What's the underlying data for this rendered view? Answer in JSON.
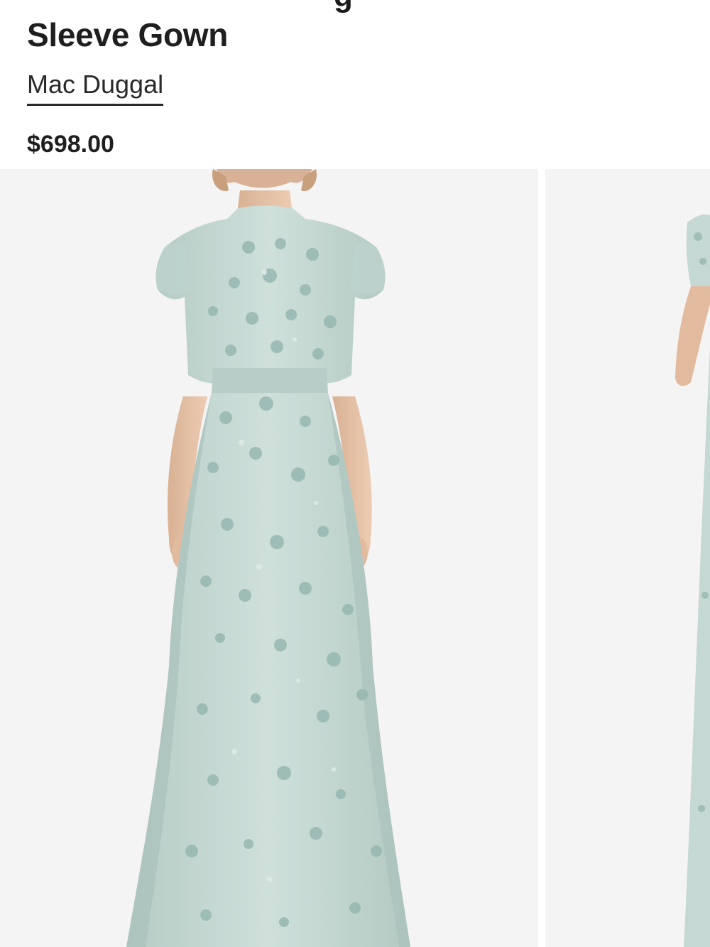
{
  "product": {
    "title_fragment_above": "g",
    "title": "Sleeve Gown",
    "brand": "Mac Duggal",
    "price": "$698.00"
  },
  "gallery": {
    "images": [
      {
        "subject": "sage-green-beaded-floral-flutter-sleeve-gown-front"
      },
      {
        "subject": "sage-green-beaded-floral-flutter-sleeve-gown-side"
      }
    ]
  },
  "colors": {
    "text": "#1f1f1f",
    "gallery_bg": "#f4f4f4",
    "gown": "#c5d8d3",
    "gown_shadow": "#afc6c0",
    "embroidery": "#8fb3ab",
    "skin": "#e6c2a6"
  }
}
